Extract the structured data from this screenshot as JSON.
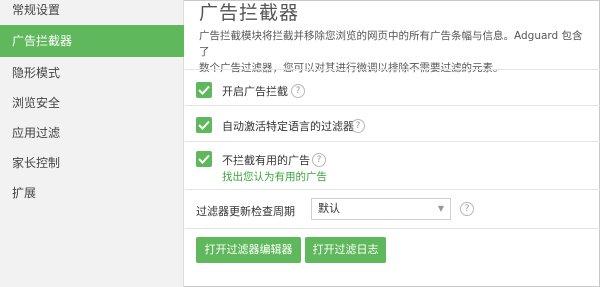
{
  "sidebar": {
    "items": [
      {
        "label": "常规设置"
      },
      {
        "label": "广告拦截器"
      },
      {
        "label": "隐形模式"
      },
      {
        "label": "浏览安全"
      },
      {
        "label": "应用过滤"
      },
      {
        "label": "家长控制"
      },
      {
        "label": "扩展"
      }
    ]
  },
  "main": {
    "title": "广告拦截器",
    "description_line1": "广告拦截模块将拦截并移除您浏览的网页中的所有广告条幅与信息。Adguard 包含了",
    "description_line2": "数个广告过滤器，您可以对其进行微调以排除不需要过滤的元素。",
    "options": [
      {
        "label": "开启广告拦截",
        "checked": true
      },
      {
        "label": "自动激活特定语言的过滤器",
        "checked": true
      },
      {
        "label": "不拦截有用的广告",
        "checked": true
      }
    ],
    "useful_ads_link": "找出您认为有用的广告",
    "help_glyph": "?",
    "update_period": {
      "label": "过滤器更新检查周期",
      "value": "默认",
      "caret": "▼"
    },
    "buttons": {
      "open_editor": "打开过滤器编辑器",
      "open_log": "打开过滤日志"
    }
  },
  "colors": {
    "accent": "#5fb85c",
    "link": "#3aa43a"
  }
}
